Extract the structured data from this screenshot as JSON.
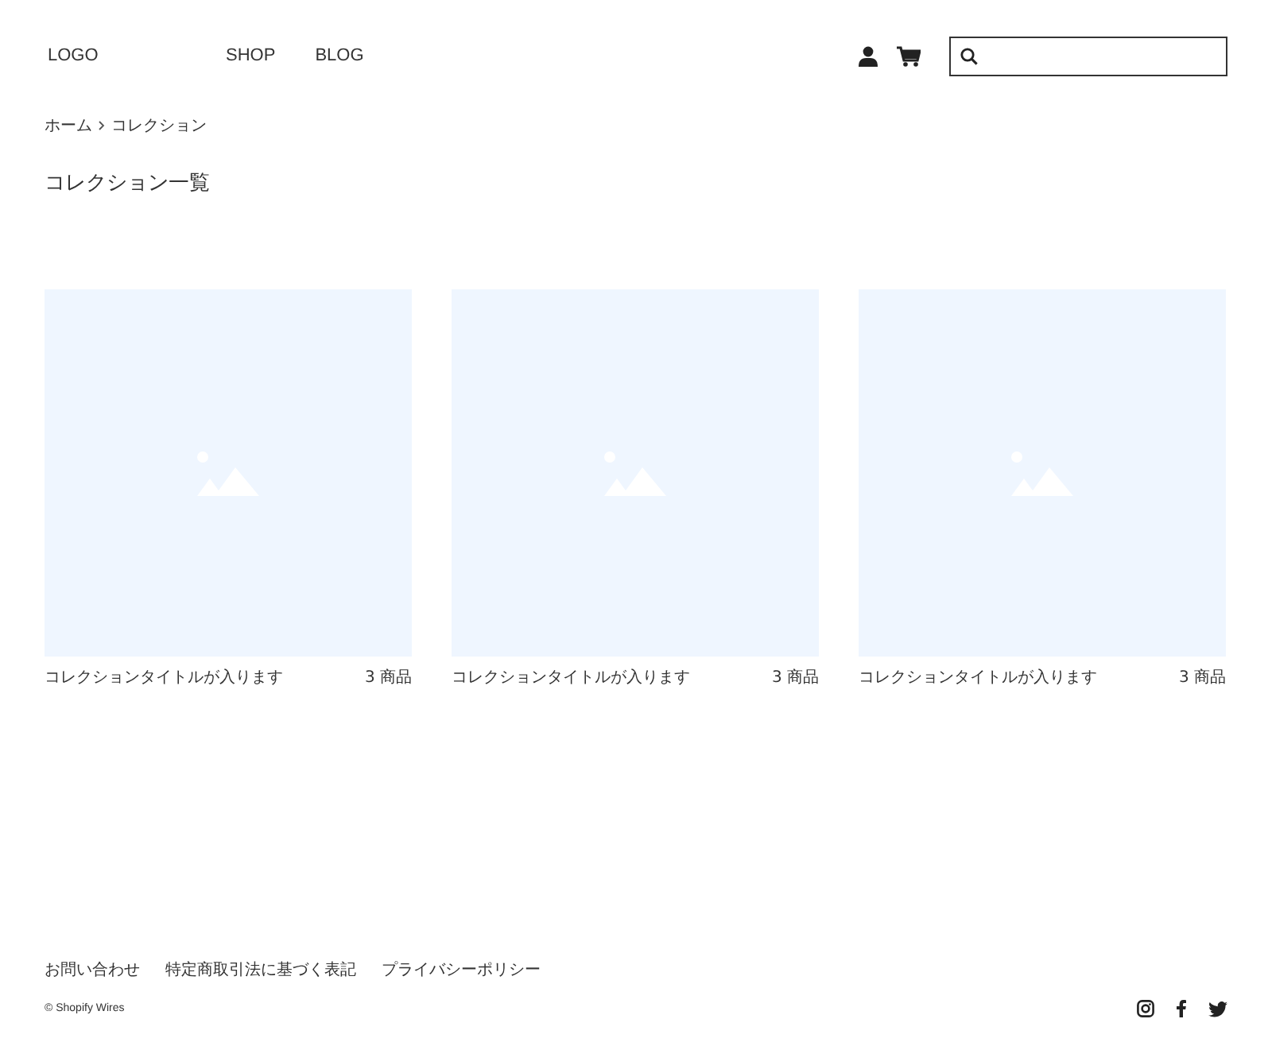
{
  "header": {
    "logo": "LOGO",
    "nav": [
      "SHOP",
      "BLOG"
    ]
  },
  "breadcrumb": [
    "ホーム",
    "コレクション"
  ],
  "title": "コレクション一覧",
  "collections": [
    {
      "title": "コレクションタイトルが入ります",
      "count": "3 商品"
    },
    {
      "title": "コレクションタイトルが入ります",
      "count": "3 商品"
    },
    {
      "title": "コレクションタイトルが入ります",
      "count": "3 商品"
    }
  ],
  "footer": {
    "links": [
      "お問い合わせ",
      "特定商取引法に基づく表記",
      "プライバシーポリシー"
    ],
    "copyright": "© Shopify Wires"
  }
}
